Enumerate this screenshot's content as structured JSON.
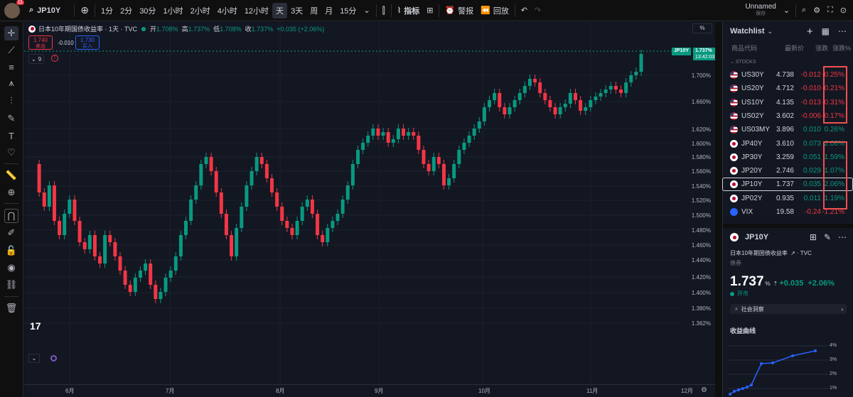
{
  "toolbar": {
    "badge": "11",
    "symbol": "JP10Y",
    "intervals": [
      "1分",
      "2分",
      "30分",
      "1小时",
      "2小时",
      "4小时",
      "12小时",
      "天",
      "3天",
      "周",
      "月",
      "15分"
    ],
    "active_interval": "天",
    "indicators_label": "指标",
    "alert_label": "警报",
    "replay_label": "回放",
    "layout_name": "Unnamed",
    "layout_status": "保存"
  },
  "legend": {
    "title": "日本10年期国债收益率 · 1天 · TVC",
    "open_label": "开",
    "open": "1.708%",
    "high_label": "高",
    "high": "1.737%",
    "low_label": "低",
    "low": "1.708%",
    "close_label": "收",
    "close": "1.737%",
    "change": "+0.035 (+2.06%)",
    "sell_price": "1.740",
    "sell_label": "卖出",
    "spread": "-0.010",
    "buy_price": "1.730",
    "buy_label": "买入",
    "indicators_count": "9",
    "unit_button": "%"
  },
  "price_tag": {
    "symbol": "JP10Y",
    "price": "1.737%",
    "countdown": "13:42:03"
  },
  "x_axis": [
    "6月",
    "7月",
    "8月",
    "9月",
    "10月",
    "11月",
    "12月"
  ],
  "watchlist": {
    "title": "Watchlist",
    "col_symbol": "商品代码",
    "col_last": "最新价",
    "col_chg": "涨跌",
    "col_chgp": "涨跌%",
    "section": "STOCKS",
    "rows": [
      {
        "flag": "us",
        "sym": "US30Y",
        "last": "4.738",
        "chg": "-0.012",
        "chgp": "-0.25%",
        "dir": "down"
      },
      {
        "flag": "us",
        "sym": "US20Y",
        "last": "4.712",
        "chg": "-0.010",
        "chgp": "-0.21%",
        "dir": "down"
      },
      {
        "flag": "us",
        "sym": "US10Y",
        "last": "4.135",
        "chg": "-0.013",
        "chgp": "-0.31%",
        "dir": "down"
      },
      {
        "flag": "us",
        "sym": "US02Y",
        "last": "3.602",
        "chg": "-0.006",
        "chgp": "-0.17%",
        "dir": "down"
      },
      {
        "flag": "us",
        "sym": "US03MY",
        "last": "3.896",
        "chg": "0.010",
        "chgp": "0.26%",
        "dir": "up"
      },
      {
        "flag": "jp",
        "sym": "JP40Y",
        "last": "3.610",
        "chg": "0.073",
        "chgp": "2.06%",
        "dir": "up"
      },
      {
        "flag": "jp",
        "sym": "JP30Y",
        "last": "3.259",
        "chg": "0.051",
        "chgp": "1.59%",
        "dir": "up"
      },
      {
        "flag": "jp",
        "sym": "JP20Y",
        "last": "2.746",
        "chg": "0.029",
        "chgp": "1.07%",
        "dir": "up"
      },
      {
        "flag": "jp",
        "sym": "JP10Y",
        "last": "1.737",
        "chg": "0.035",
        "chgp": "2.06%",
        "dir": "up"
      },
      {
        "flag": "jp",
        "sym": "JP02Y",
        "last": "0.935",
        "chg": "0.011",
        "chgp": "1.19%",
        "dir": "up"
      },
      {
        "flag": "vix",
        "sym": "VIX",
        "last": "19.58",
        "chg": "-0.24",
        "chgp": "-1.21%",
        "dir": "down"
      }
    ]
  },
  "details": {
    "symbol": "JP10Y",
    "name": "日本10年期国债收益率",
    "exchange": "TVC",
    "type": "债券",
    "price": "1.737",
    "unit": "%",
    "change": "+0.035",
    "change_pct": "+2.06%",
    "status": "开市",
    "ideas_label": "社会洞察",
    "curve_title": "收益曲线",
    "curve_ticks": [
      "4%",
      "3%",
      "2%",
      "1%"
    ]
  },
  "chart_data": {
    "type": "candlestick",
    "y_ticks": [
      "1.700%",
      "1.660%",
      "1.620%",
      "1.600%",
      "1.580%",
      "1.560%",
      "1.540%",
      "1.520%",
      "1.500%",
      "1.480%",
      "1.460%",
      "1.440%",
      "1.420%",
      "1.400%",
      "1.380%",
      "1.362%"
    ],
    "colors": {
      "up": "#089981",
      "down": "#f23645"
    }
  }
}
